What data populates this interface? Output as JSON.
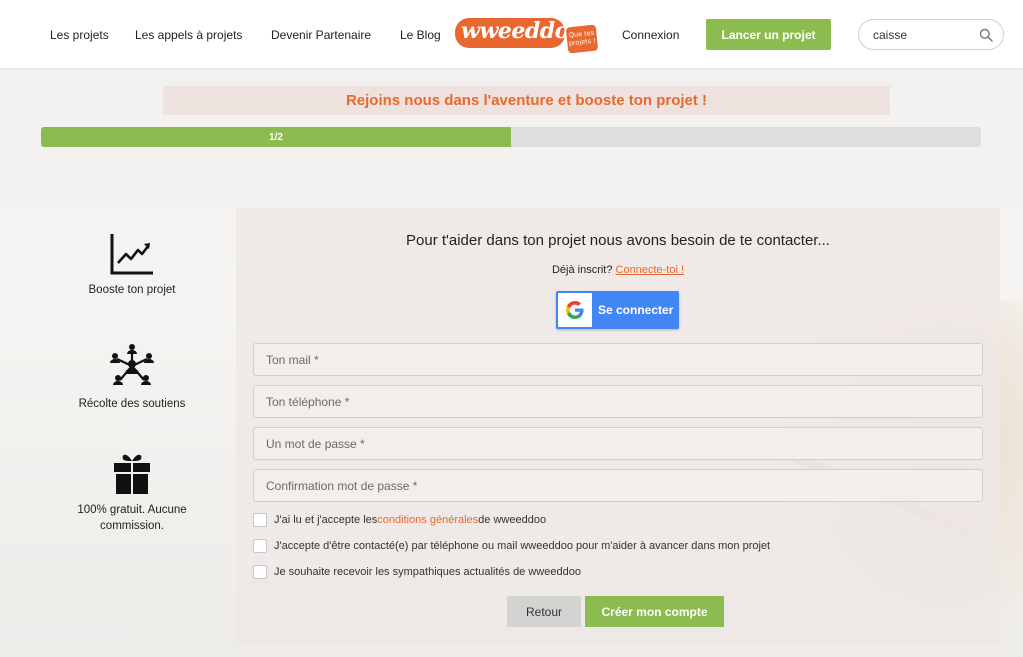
{
  "header": {
    "nav": [
      {
        "label": "Les projets"
      },
      {
        "label": "Les appels à projets"
      },
      {
        "label": "Devenir Partenaire"
      },
      {
        "label": "Le Blog"
      }
    ],
    "logo": {
      "wordmark": "wweeddoo",
      "badge": "Que tes projets !"
    },
    "login_label": "Connexion",
    "cta_label": "Lancer un projet",
    "search": {
      "value": "caisse",
      "icon": "search-icon"
    }
  },
  "banner": {
    "text": "Rejoins nous dans l'aventure et booste ton projet !"
  },
  "progress": {
    "label": "1/2",
    "fraction": 0.5
  },
  "features": [
    {
      "icon": "chart-trend-icon",
      "label": "Booste ton projet"
    },
    {
      "icon": "network-people-icon",
      "label": "Récolte des soutiens"
    },
    {
      "icon": "gift-icon",
      "label": "100% gratuit. Aucune commission."
    }
  ],
  "form": {
    "title": "Pour t'aider dans ton projet nous avons besoin de te contacter...",
    "already_text": "Déjà inscrit?",
    "already_link": "Connecte-toi !",
    "google_label": "Se connecter",
    "fields": {
      "email_placeholder": "Ton mail *",
      "phone_placeholder": "Ton téléphone *",
      "password_placeholder": "Un mot de passe *",
      "confirm_placeholder": "Confirmation mot de passe *"
    },
    "checks": {
      "terms_before": "J'ai lu et j'accepte les",
      "terms_link": "conditions générales",
      "terms_after": "de wweeddoo",
      "contact": "J'accepte d'être contacté(e) par téléphone ou mail wweeddoo pour m'aider à avancer dans mon projet",
      "news": "Je souhaite recevoir les sympathiques actualités de wweeddoo"
    },
    "back_label": "Retour",
    "submit_label": "Créer mon compte"
  },
  "colors": {
    "accent": "#e8682f",
    "green": "#8cbb4f",
    "google": "#4285f4"
  }
}
